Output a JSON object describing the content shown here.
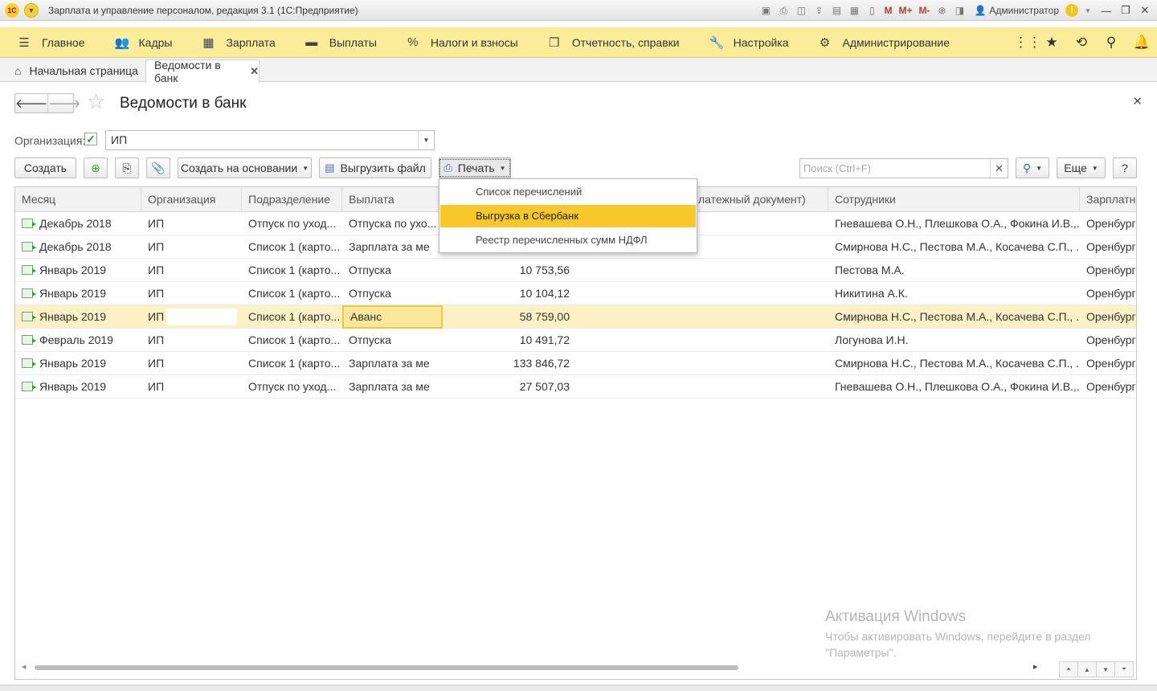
{
  "window": {
    "logo": "1С",
    "title": "Зарплата и управление персоналом, редакция 3.1  (1С:Предприятие)",
    "user": "Администратор",
    "toolbar_marks": [
      "M",
      "M+",
      "M-"
    ]
  },
  "sections": [
    {
      "label": "Главное",
      "icon": "hamburger-icon",
      "glyph": "☰"
    },
    {
      "label": "Кадры",
      "icon": "people-icon",
      "glyph": "👥"
    },
    {
      "label": "Зарплата",
      "icon": "calculator-icon",
      "glyph": "▦"
    },
    {
      "label": "Выплаты",
      "icon": "wallet-icon",
      "glyph": "▬"
    },
    {
      "label": "Налоги и взносы",
      "icon": "percent-icon",
      "glyph": "%"
    },
    {
      "label": "Отчетность, справки",
      "icon": "report-icon",
      "glyph": "❐"
    },
    {
      "label": "Настройка",
      "icon": "wrench-icon",
      "glyph": "🔧"
    },
    {
      "label": "Администрирование",
      "icon": "gear-icon",
      "glyph": "⚙"
    }
  ],
  "tabs": {
    "home": "Начальная страница",
    "active": "Ведомости в банк"
  },
  "form": {
    "title": "Ведомости в банк",
    "org_label": "Организация:",
    "org_value": "ИП"
  },
  "commands": {
    "create": "Создать",
    "create_based": "Создать на основании",
    "export_file": "Выгрузить файл",
    "print": "Печать",
    "search_placeholder": "Поиск (Ctrl+F)",
    "more": "Еще",
    "help": "?"
  },
  "print_menu": [
    "Список перечислений",
    "Выгрузка в Сбербанк",
    "Реестр перечисленных сумм НДФЛ"
  ],
  "table": {
    "columns": [
      "Месяц",
      "Организация",
      "Подразделение",
      "Выплата",
      "",
      "латежный документ)",
      "Сотрудники",
      "Зарплатны"
    ],
    "rows": [
      {
        "month": "Декабрь 2018",
        "org": "ИП",
        "dept": "Отпуск по уход...",
        "pay": "Отпуска по ухо...",
        "sum": "",
        "staff": "Гневашева О.Н., Плешкова О.А., Фокина И.В.,...",
        "proj": "Оренбург"
      },
      {
        "month": "Декабрь 2018",
        "org": "ИП",
        "dept": "Список 1 (карто...",
        "pay": "Зарплата за ме",
        "sum": "",
        "staff": "Смирнова Н.С., Пестова М.А., Косачева С.П., ...",
        "proj": "Оренбург"
      },
      {
        "month": "Январь 2019",
        "org": "ИП",
        "dept": "Список 1 (карто...",
        "pay": "Отпуска",
        "sum": "10 753,56",
        "staff": "Пестова М.А.",
        "proj": "Оренбург"
      },
      {
        "month": "Январь 2019",
        "org": "ИП",
        "dept": "Список 1 (карто...",
        "pay": "Отпуска",
        "sum": "10 104,12",
        "staff": "Никитина А.К.",
        "proj": "Оренбург"
      },
      {
        "month": "Январь 2019",
        "org": "ИП",
        "dept": "Список 1 (карто...",
        "pay": "Аванс",
        "sum": "58 759,00",
        "staff": "Смирнова Н.С., Пестова М.А., Косачева С.П., ...",
        "proj": "Оренбург"
      },
      {
        "month": "Февраль 2019",
        "org": "ИП",
        "dept": "Список 1 (карто...",
        "pay": "Отпуска",
        "sum": "10 491,72",
        "staff": "Логунова И.Н.",
        "proj": "Оренбург"
      },
      {
        "month": "Январь 2019",
        "org": "ИП",
        "dept": "Список 1 (карто...",
        "pay": "Зарплата за ме",
        "sum": "133 846,72",
        "staff": "Смирнова Н.С., Пестова М.А., Косачева С.П., ...",
        "proj": "Оренбург"
      },
      {
        "month": "Январь 2019",
        "org": "ИП",
        "dept": "Отпуск по уход...",
        "pay": "Зарплата за ме",
        "sum": "27 507,03",
        "staff": "Гневашева О.Н., Плешкова О.А., Фокина И.В.,...",
        "proj": "Оренбург"
      }
    ]
  },
  "watermark": {
    "line1": "Активация Windows",
    "line2": "Чтобы активировать Windows, перейдите в раздел \"Параметры\"."
  }
}
